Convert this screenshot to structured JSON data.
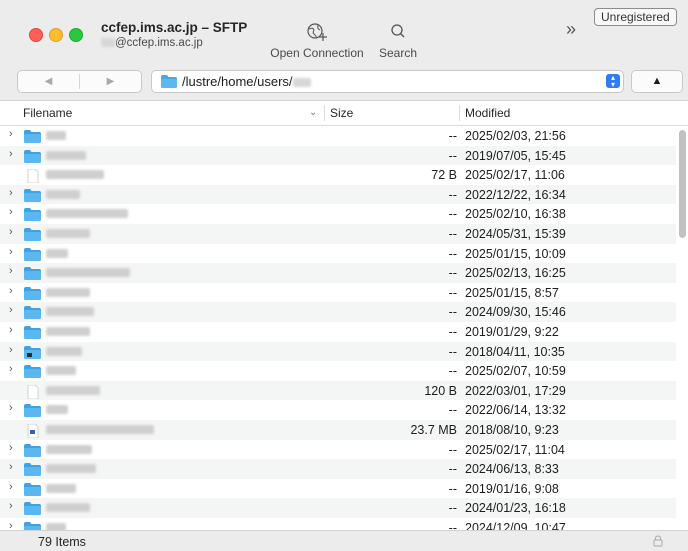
{
  "window": {
    "title": "ccfep.ims.ac.jp – SFTP",
    "subtitle": "@ccfep.ims.ac.jp",
    "unregistered_label": "Unregistered"
  },
  "toolbar": {
    "open_connection_label": "Open Connection",
    "search_label": "Search",
    "more_label": "»"
  },
  "pathbar": {
    "back_glyph": "◀",
    "forward_glyph": "▶",
    "path": "/lustre/home/users/",
    "up_glyph": "▲"
  },
  "columns": {
    "filename": "Filename",
    "size": "Size",
    "modified": "Modified"
  },
  "files": [
    {
      "type": "folder",
      "size": "--",
      "modified": "2025/02/03, 21:56"
    },
    {
      "type": "folder",
      "size": "--",
      "modified": "2019/07/05, 15:45"
    },
    {
      "type": "file",
      "size": "72 B",
      "modified": "2025/02/17, 11:06"
    },
    {
      "type": "folder",
      "size": "--",
      "modified": "2022/12/22, 16:34"
    },
    {
      "type": "folder",
      "size": "--",
      "modified": "2025/02/10, 16:38"
    },
    {
      "type": "folder",
      "size": "--",
      "modified": "2024/05/31, 15:39"
    },
    {
      "type": "folder",
      "size": "--",
      "modified": "2025/01/15, 10:09"
    },
    {
      "type": "folder",
      "size": "--",
      "modified": "2025/02/13, 16:25"
    },
    {
      "type": "folder",
      "size": "--",
      "modified": "2025/01/15, 8:57"
    },
    {
      "type": "folder",
      "size": "--",
      "modified": "2024/09/30, 15:46"
    },
    {
      "type": "folder",
      "size": "--",
      "modified": "2019/01/29, 9:22"
    },
    {
      "type": "folder-app",
      "size": "--",
      "modified": "2018/04/11, 10:35"
    },
    {
      "type": "folder",
      "size": "--",
      "modified": "2025/02/07, 10:59"
    },
    {
      "type": "file",
      "size": "120 B",
      "modified": "2022/03/01, 17:29"
    },
    {
      "type": "folder",
      "size": "--",
      "modified": "2022/06/14, 13:32"
    },
    {
      "type": "pdf",
      "size": "23.7 MB",
      "modified": "2018/08/10, 9:23"
    },
    {
      "type": "folder",
      "size": "--",
      "modified": "2025/02/17, 11:04"
    },
    {
      "type": "folder",
      "size": "--",
      "modified": "2024/06/13, 8:33"
    },
    {
      "type": "folder",
      "size": "--",
      "modified": "2019/01/16, 9:08"
    },
    {
      "type": "folder",
      "size": "--",
      "modified": "2024/01/23, 16:18"
    },
    {
      "type": "folder",
      "size": "--",
      "modified": "2024/12/09, 10:47"
    }
  ],
  "footer": {
    "item_count": "79 Items"
  }
}
